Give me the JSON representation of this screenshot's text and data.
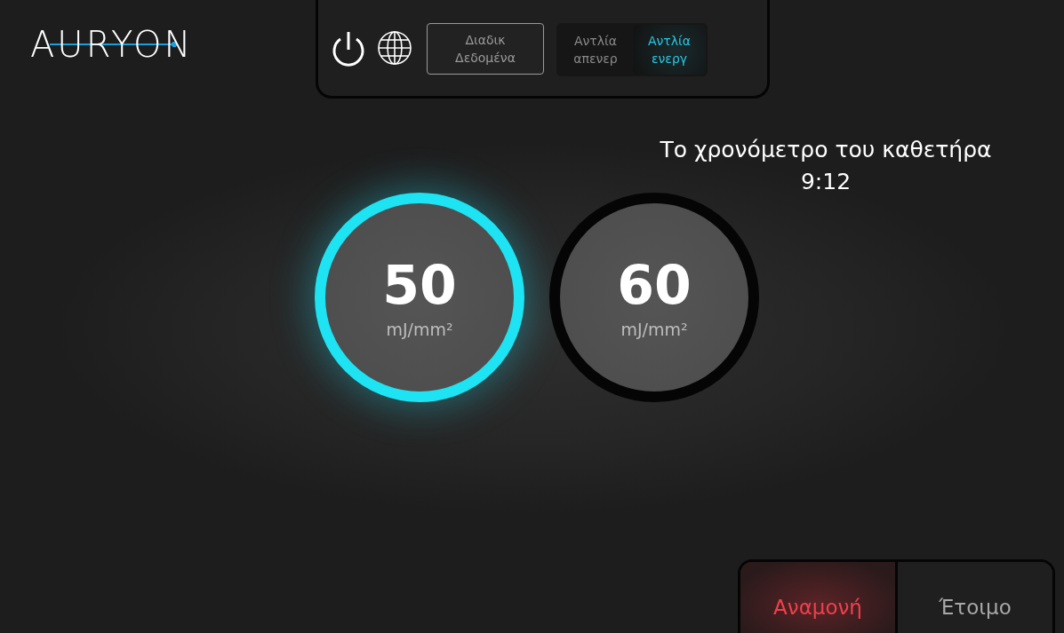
{
  "logo": {
    "text": "AURYON"
  },
  "toolbar": {
    "data_button": {
      "label": "Διαδικ\nΔεδομένα"
    },
    "pump": [
      {
        "label": "Αντλία\nαπενερ",
        "selected": false
      },
      {
        "label": "Αντλία\nενεργ",
        "selected": true
      }
    ]
  },
  "catheter_timer": {
    "label": "Το χρονόμετρο του καθετήρα",
    "value": "9:12"
  },
  "energy_levels": [
    {
      "value": "50",
      "unit": "mJ/mm²",
      "selected": true
    },
    {
      "value": "60",
      "unit": "mJ/mm²",
      "selected": false
    }
  ],
  "modes": [
    {
      "label": "Αναμονή",
      "selected": true
    },
    {
      "label": "Έτοιμο",
      "selected": false
    }
  ]
}
